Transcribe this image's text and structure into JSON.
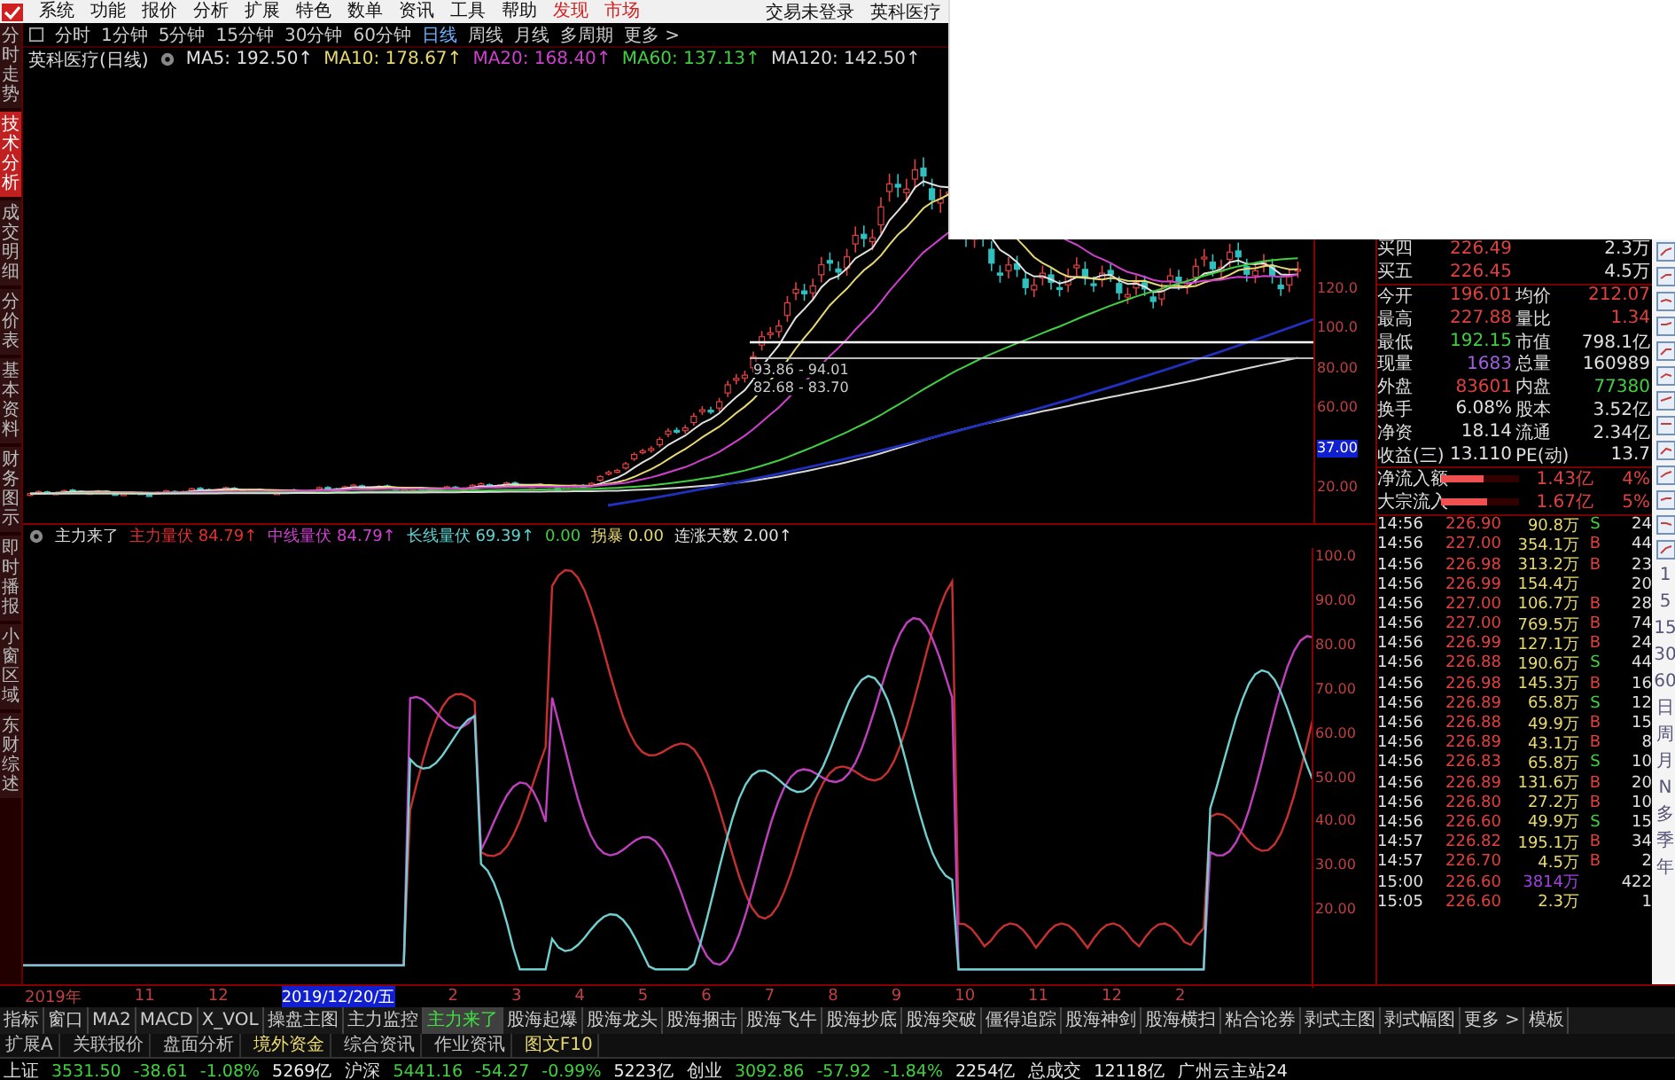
{
  "menu": {
    "items": [
      {
        "label": "系统",
        "kind": "plain"
      },
      {
        "label": "功能",
        "kind": "plain"
      },
      {
        "label": "报价",
        "kind": "plain"
      },
      {
        "label": "分析",
        "kind": "plain"
      },
      {
        "label": "扩展",
        "kind": "plain"
      },
      {
        "label": "特色",
        "kind": "plain"
      },
      {
        "label": "数单",
        "kind": "plain"
      },
      {
        "label": "资讯",
        "kind": "plain"
      },
      {
        "label": "工具",
        "kind": "plain"
      },
      {
        "label": "帮助",
        "kind": "plain"
      },
      {
        "label": "发现",
        "kind": "accent"
      },
      {
        "label": "市场",
        "kind": "accent"
      }
    ],
    "login": "交易未登录",
    "stock": "英科医疗"
  },
  "side_tabs": [
    {
      "label": "分时走势",
      "selected": false
    },
    {
      "label": "技术分析",
      "selected": true
    },
    {
      "label": "成交明细",
      "selected": false
    },
    {
      "label": "分价表",
      "selected": false
    },
    {
      "label": "基本资料",
      "selected": false
    },
    {
      "label": "财务图示",
      "selected": false
    },
    {
      "label": "即时播报",
      "selected": false
    },
    {
      "label": "小窗区域",
      "selected": false
    },
    {
      "label": "东财综述",
      "selected": false
    }
  ],
  "periods": [
    {
      "label": "分时",
      "selected": false
    },
    {
      "label": "1分钟",
      "selected": false
    },
    {
      "label": "5分钟",
      "selected": false
    },
    {
      "label": "15分钟",
      "selected": false
    },
    {
      "label": "30分钟",
      "selected": false
    },
    {
      "label": "60分钟",
      "selected": false
    },
    {
      "label": "日线",
      "selected": true
    },
    {
      "label": "周线",
      "selected": false
    },
    {
      "label": "月线",
      "selected": false
    },
    {
      "label": "多周期",
      "selected": false
    },
    {
      "label": "更多 >",
      "selected": false
    }
  ],
  "ma_line": {
    "title": "英科医疗(日线)",
    "items": [
      {
        "label": "MA5: 192.50↑",
        "color": "#e0e0e0"
      },
      {
        "label": "MA10: 178.67↑",
        "color": "#e8d870"
      },
      {
        "label": "MA20: 168.40↑",
        "color": "#d040d0"
      },
      {
        "label": "MA60: 137.13↑",
        "color": "#40d040"
      },
      {
        "label": "MA120: 142.50↑",
        "color": "#d8d8d8"
      }
    ]
  },
  "price_marks": [
    "93.86 - 94.01",
    "82.68 - 83.70"
  ],
  "price_axis": [
    {
      "label": "120.0",
      "kind": "tick"
    },
    {
      "label": "100.0",
      "kind": "tick"
    },
    {
      "label": "80.00",
      "kind": "tick"
    },
    {
      "label": "60.00",
      "kind": "tick"
    },
    {
      "label": "37.00",
      "kind": "cursor"
    },
    {
      "label": "20.00",
      "kind": "tick"
    }
  ],
  "indicator": {
    "title": "主力来了",
    "items": [
      {
        "label": "主力量伏 84.79↑",
        "color": "#e03030"
      },
      {
        "label": "中线量伏 84.79↑",
        "color": "#d040d0"
      },
      {
        "label": "长线量伏 69.39↑",
        "color": "#60d0d0"
      },
      {
        "label": "0.00",
        "color": "#40d040"
      },
      {
        "label": "拐暴 0.00",
        "color": "#e8d870"
      },
      {
        "label": "连涨天数 2.00↑",
        "color": "#e0e0e0"
      }
    ]
  },
  "indicator_axis": [
    "100.0",
    "90.00",
    "80.00",
    "70.00",
    "60.00",
    "50.00",
    "40.00",
    "30.00",
    "20.00"
  ],
  "quote": {
    "depth": [
      {
        "label": "买四",
        "price": "226.49",
        "volume": "2.3万"
      },
      {
        "label": "买五",
        "price": "226.45",
        "volume": "4.5万"
      }
    ],
    "stats": [
      {
        "items": [
          {
            "label": "今开",
            "value": "196.01",
            "kind": "up"
          },
          {
            "label": "均价",
            "value": "212.07",
            "kind": "up"
          }
        ]
      },
      {
        "items": [
          {
            "label": "最高",
            "value": "227.88",
            "kind": "up"
          },
          {
            "label": "量比",
            "value": "1.34",
            "kind": "up"
          }
        ]
      },
      {
        "items": [
          {
            "label": "最低",
            "value": "192.15",
            "kind": "down"
          },
          {
            "label": "市值",
            "value": "798.1亿",
            "kind": "flat"
          }
        ]
      },
      {
        "items": [
          {
            "label": "现量",
            "value": "1683",
            "kind": "volume"
          },
          {
            "label": "总量",
            "value": "160989",
            "kind": "flat"
          }
        ]
      },
      {
        "items": [
          {
            "label": "外盘",
            "value": "83601",
            "kind": "up"
          },
          {
            "label": "内盘",
            "value": "77380",
            "kind": "down"
          }
        ]
      },
      {
        "items": [
          {
            "label": "换手",
            "value": "6.08%",
            "kind": "flat"
          },
          {
            "label": "股本",
            "value": "3.52亿",
            "kind": "flat"
          }
        ]
      },
      {
        "items": [
          {
            "label": "净资",
            "value": "18.14",
            "kind": "flat"
          },
          {
            "label": "流通",
            "value": "2.34亿",
            "kind": "flat"
          }
        ]
      },
      {
        "items": [
          {
            "label": "收益(三)",
            "value": "13.110",
            "kind": "flat"
          },
          {
            "label": "PE(动)",
            "value": "13.7",
            "kind": "flat"
          }
        ]
      }
    ],
    "flows": [
      {
        "label": "净流入额",
        "level": 0.55,
        "value": "1.43亿",
        "pct": "4%"
      },
      {
        "label": "大宗流入",
        "level": 0.6,
        "value": "1.67亿",
        "pct": "5%"
      }
    ],
    "trades": [
      {
        "time": "14:56",
        "price": "226.90",
        "volume": "90.8万",
        "side": "S",
        "kind": "sell",
        "count": "24"
      },
      {
        "time": "14:56",
        "price": "227.00",
        "volume": "354.1万",
        "side": "B",
        "kind": "buy",
        "count": "44"
      },
      {
        "time": "14:56",
        "price": "226.98",
        "volume": "313.2万",
        "side": "B",
        "kind": "buy",
        "count": "23"
      },
      {
        "time": "14:56",
        "price": "226.99",
        "volume": "154.4万",
        "kind": "none",
        "count": "20"
      },
      {
        "time": "14:56",
        "price": "227.00",
        "volume": "106.7万",
        "side": "B",
        "kind": "buy",
        "count": "28"
      },
      {
        "time": "14:56",
        "price": "227.00",
        "volume": "769.5万",
        "side": "B",
        "kind": "buy",
        "count": "74"
      },
      {
        "time": "14:56",
        "price": "226.99",
        "volume": "127.1万",
        "side": "B",
        "kind": "buy",
        "count": "24"
      },
      {
        "time": "14:56",
        "price": "226.88",
        "volume": "190.6万",
        "side": "S",
        "kind": "sell",
        "count": "44"
      },
      {
        "time": "14:56",
        "price": "226.98",
        "volume": "145.3万",
        "side": "B",
        "kind": "buy",
        "count": "16"
      },
      {
        "time": "14:56",
        "price": "226.89",
        "volume": "65.8万",
        "side": "S",
        "kind": "sell",
        "count": "12"
      },
      {
        "time": "14:56",
        "price": "226.88",
        "volume": "49.9万",
        "side": "B",
        "kind": "buy",
        "count": "15"
      },
      {
        "time": "14:56",
        "price": "226.89",
        "volume": "43.1万",
        "side": "B",
        "kind": "buy",
        "count": "8"
      },
      {
        "time": "14:56",
        "price": "226.83",
        "volume": "65.8万",
        "side": "S",
        "kind": "sell",
        "count": "10"
      },
      {
        "time": "14:56",
        "price": "226.89",
        "volume": "131.6万",
        "side": "B",
        "kind": "buy",
        "count": "20"
      },
      {
        "time": "14:56",
        "price": "226.80",
        "volume": "27.2万",
        "side": "B",
        "kind": "buy",
        "count": "10"
      },
      {
        "time": "14:56",
        "price": "226.60",
        "volume": "49.9万",
        "side": "S",
        "kind": "sell",
        "count": "15"
      },
      {
        "time": "14:57",
        "price": "226.82",
        "volume": "195.1万",
        "side": "B",
        "kind": "buy",
        "count": "34"
      },
      {
        "time": "14:57",
        "price": "226.70",
        "volume": "4.5万",
        "side": "B",
        "kind": "buy",
        "count": "2"
      },
      {
        "time": "15:00",
        "price": "226.60",
        "volume": "3814万",
        "kind": "block",
        "count": "422"
      },
      {
        "time": "15:05",
        "price": "226.60",
        "volume": "2.3万",
        "kind": "none",
        "count": "1"
      }
    ]
  },
  "toolbar_periods": [
    "1",
    "5",
    "15",
    "30",
    "60",
    "日",
    "周",
    "月",
    "N",
    "多",
    "季",
    "年"
  ],
  "date_axis": [
    {
      "label": "2019年",
      "selected": false
    },
    {
      "label": "11",
      "selected": false
    },
    {
      "label": "12",
      "selected": false
    },
    {
      "label": "2019/12/20/五",
      "selected": true
    },
    {
      "label": "2",
      "selected": false
    },
    {
      "label": "3",
      "selected": false
    },
    {
      "label": "4",
      "selected": false
    },
    {
      "label": "5",
      "selected": false
    },
    {
      "label": "6",
      "selected": false
    },
    {
      "label": "7",
      "selected": false
    },
    {
      "label": "8",
      "selected": false
    },
    {
      "label": "9",
      "selected": false
    },
    {
      "label": "10",
      "selected": false
    },
    {
      "label": "11",
      "selected": false
    },
    {
      "label": "12",
      "selected": false
    },
    {
      "label": "2",
      "selected": false
    }
  ],
  "indicator_tabs": [
    {
      "label": "指标",
      "selected": false
    },
    {
      "label": "窗口",
      "selected": false
    },
    {
      "label": "MA2",
      "selected": false
    },
    {
      "label": "MACD",
      "selected": false
    },
    {
      "label": "X_VOL",
      "selected": false
    },
    {
      "label": "操盘主图",
      "selected": false
    },
    {
      "label": "主力监控",
      "selected": false
    },
    {
      "label": "主力来了",
      "selected": true
    },
    {
      "label": "股海起爆",
      "selected": false
    },
    {
      "label": "股海龙头",
      "selected": false
    },
    {
      "label": "股海捆击",
      "selected": false
    },
    {
      "label": "股海飞牛",
      "selected": false
    },
    {
      "label": "股海抄底",
      "selected": false
    },
    {
      "label": "股海突破",
      "selected": false
    },
    {
      "label": "僵得追踪",
      "selected": false
    },
    {
      "label": "股海神剑",
      "selected": false
    },
    {
      "label": "股海横扫",
      "selected": false
    },
    {
      "label": "粘合论券",
      "selected": false
    },
    {
      "label": "剥式主图",
      "selected": false
    },
    {
      "label": "剥式幅图",
      "selected": false
    },
    {
      "label": "更多 >",
      "selected": false
    },
    {
      "label": "模板",
      "selected": false
    }
  ],
  "extension_tabs": [
    {
      "label": "扩展A",
      "kind": "plain"
    },
    {
      "label": "关联报价",
      "kind": "plain"
    },
    {
      "label": "盘面分析",
      "kind": "plain"
    },
    {
      "label": "境外资金",
      "kind": "accent"
    },
    {
      "label": "综合资讯",
      "kind": "plain"
    },
    {
      "label": "作业资讯",
      "kind": "plain"
    },
    {
      "label": "图文F10",
      "kind": "accent"
    }
  ],
  "status_bar": {
    "indices": [
      {
        "name": "上证",
        "price": "3531.50",
        "change": "-38.61",
        "pct": "-1.08%",
        "amount": "5269亿"
      },
      {
        "name": "沪深",
        "price": "5441.16",
        "change": "-54.27",
        "pct": "-0.99%",
        "amount": "5223亿"
      },
      {
        "name": "创业",
        "price": "3092.86",
        "change": "-57.92",
        "pct": "-1.84%",
        "amount": "2254亿"
      }
    ],
    "total_label": "总成交",
    "total": "12118亿",
    "server": "广州云主站24"
  }
}
